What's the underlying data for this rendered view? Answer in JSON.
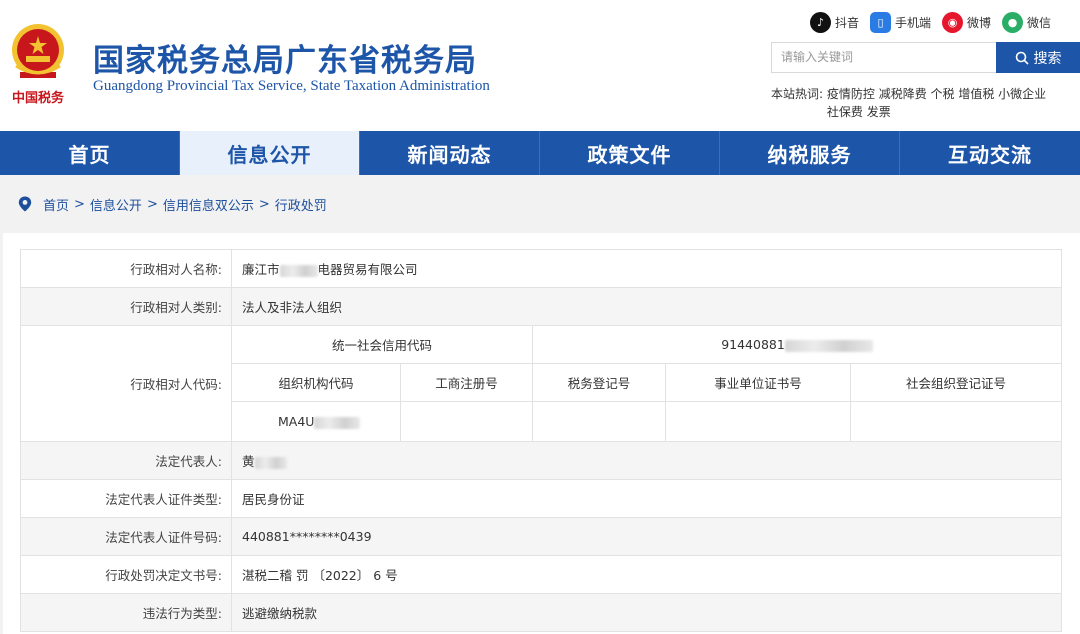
{
  "header": {
    "title": "国家税务总局广东省税务局",
    "subtitle": "Guangdong Provincial Tax Service, State Taxation Administration",
    "emblem_text": "中国税务",
    "social": [
      {
        "icon": "douyin-icon",
        "label": "抖音",
        "color": "#111111"
      },
      {
        "icon": "mobile-icon",
        "label": "手机端",
        "color": "#2a7be4"
      },
      {
        "icon": "weibo-icon",
        "label": "微博",
        "color": "#e6162d"
      },
      {
        "icon": "wechat-icon",
        "label": "微信",
        "color": "#2aae67"
      }
    ],
    "search": {
      "placeholder": "请输入关键词",
      "button_label": "搜索"
    },
    "hot": {
      "label": "本站热词:",
      "line1": "疫情防控 减税降费 个税 增值税 小微企业",
      "line2": "社保费 发票"
    }
  },
  "nav": {
    "items": [
      "首页",
      "信息公开",
      "新闻动态",
      "政策文件",
      "纳税服务",
      "互动交流"
    ],
    "active": "信息公开"
  },
  "breadcrumb": {
    "items": [
      "首页",
      "信息公开",
      "信用信息双公示",
      "行政处罚"
    ],
    "separator": ">"
  },
  "record": {
    "name_label": "行政相对人名称:",
    "name_prefix": "廉江市",
    "name_suffix": "电器贸易有限公司",
    "type_label": "行政相对人类别:",
    "type_value": "法人及非法人组织",
    "code_label": "行政相对人代码:",
    "credit_code_header": "统一社会信用代码",
    "credit_code_value": "91440881",
    "org_code_header": "组织机构代码",
    "business_reg_header": "工商注册号",
    "tax_reg_header": "税务登记号",
    "institution_header": "事业单位证书号",
    "social_org_header": "社会组织登记证号",
    "org_code_value": "MA4U",
    "legal_rep_label": "法定代表人:",
    "legal_rep_value": "黄",
    "id_type_label": "法定代表人证件类型:",
    "id_type_value": "居民身份证",
    "id_no_label": "法定代表人证件号码:",
    "id_no_value": "440881********0439",
    "doc_no_label": "行政处罚决定文书号:",
    "doc_no_value": "湛税二稽 罚 〔2022〕 6 号",
    "violation_label": "违法行为类型:",
    "violation_value": "逃避缴纳税款"
  },
  "colors": {
    "brand": "#1d55a8",
    "nav_active_bg": "#e8f0fb"
  }
}
